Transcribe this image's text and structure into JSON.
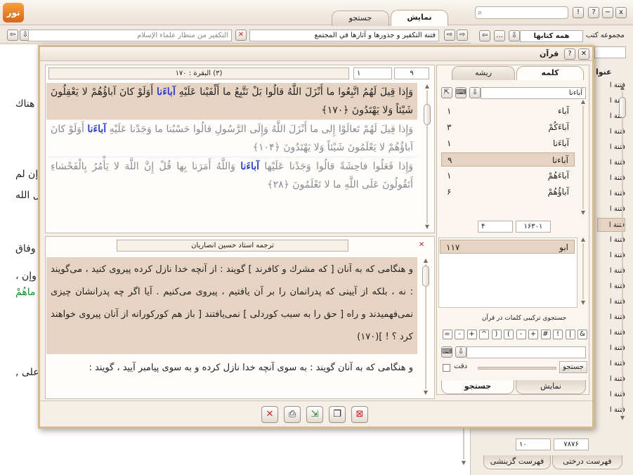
{
  "app": {
    "tabs": [
      "نمایش",
      "جستجو"
    ],
    "search_placeholder": "",
    "window_buttons": [
      "x",
      "−",
      "?",
      "!"
    ]
  },
  "docbar": {
    "left_field": "التكفير من منظار علماء الإسلام",
    "right_field": "فتنة التكفير و جذورها و آثارها في المجتمع"
  },
  "left_sidebar": {
    "collection_label": "مجموعه كتب",
    "collection_value": "همه كتابها",
    "list_header": "عنوا",
    "items": [
      "فتنة ا",
      "فتنة ا",
      "فتنة ا",
      "فتنة ا",
      "فتنة ا",
      "فتنة ا",
      "فتنة ا",
      "فتنة ا",
      "فتنة ا",
      "فتنة ا",
      "فتنة ا",
      "فتنة ا",
      "فتنة ا",
      "فتنة ا",
      "فتنة ا",
      "فتنة ا",
      "فتنة ا",
      "فتنة ا",
      "فتنة ا",
      "فتنة ا",
      "فتنة ا",
      "فتنة ا"
    ],
    "selected_index": 9,
    "page_total": "۷۸۷۶",
    "page_current": "۱۰",
    "bottom_tabs": [
      "فهرست درختی",
      "فهرست گزینشی"
    ]
  },
  "background_text": {
    "snippets": [
      "هناك",
      "إن لم",
      "ل الله.",
      "وفاق",
      "، وإن",
      "ماهُمْ",
      ", على"
    ]
  },
  "dialog": {
    "title": "قرآن",
    "verse_ref": "(۳) البقرة : ۱۷۰",
    "page_num": "۹",
    "page_total": "۱",
    "tabs": [
      "كلمه",
      "ریشه"
    ],
    "search_word": "آباءنا",
    "words": [
      {
        "word": "آباء",
        "count": "۱"
      },
      {
        "word": "آباءَكُمْ",
        "count": "۳"
      },
      {
        "word": "آباءَنا",
        "count": "۱"
      },
      {
        "word": "آباءنا",
        "count": "۹"
      },
      {
        "word": "آباءَهُمْ",
        "count": "۱"
      },
      {
        "word": "آباؤُهُمْ",
        "count": "۶"
      }
    ],
    "selected_word": 3,
    "total_left": "۴",
    "total_right": "۱۶۳۰۱",
    "root_list": [
      {
        "word": "ابو",
        "count": "۱۱۷"
      }
    ],
    "combo_label": "جستجوی تركیبی كلمات در قرآن",
    "symbols": [
      "&",
      "|",
      "!",
      "#",
      "+",
      "-",
      "(",
      ")",
      "^",
      "+",
      "-",
      "="
    ],
    "search_button": "جستجو",
    "exact_label": "دقت",
    "bottom_tabs": [
      "نمایش",
      "جستجو"
    ],
    "verses": [
      {
        "pre": "وَإِذا قِيلَ لَهُمُ اتَّبِعُوا ما أَنْزَلَ اللَّهُ قالُوا بَلْ نَتَّبِعُ ما أَلْفَيْنا عَلَيْهِ ",
        "hl": "آباءَنا",
        "post": " أَوَلَوْ كانَ آباؤُهُمْ لا يَعْقِلُونَ شَيْئاً وَلا يَهْتَدُونَ ﴿۱۷۰﴾"
      },
      {
        "pre": "وَإِذا قِيلَ لَهُمْ تَعالَوْا إِلى ما أَنْزَلَ اللَّهُ وَإِلَى الرَّسُولِ قالُوا حَسْبُنا ما وَجَدْنا عَلَيْهِ ",
        "hl": "آباءَنا",
        "post": " أَوَلَوْ كانَ آباؤُهُمْ لا يَعْلَمُونَ شَيْئاً وَلا يَهْتَدُونَ ﴿۱۰۴﴾"
      },
      {
        "pre": "وَإِذا فَعَلُوا فاحِشَةً قالُوا وَجَدْنا عَلَيْها ",
        "hl": "آباءَنا",
        "post": " وَاللَّهُ أَمَرَنا بِها قُلْ إِنَّ اللَّهَ لا يَأْمُرُ بِالْفَحْشاءِ أَتَقُولُونَ عَلَى اللَّهِ ما لا تَعْلَمُونَ ﴿۲۸﴾"
      }
    ],
    "translator": "ترجمه استاد حسین انصاریان",
    "translation": [
      "و هنگامی كه به آنان [ كه مشرك و كافرند ] گویند : از آنچه خدا نازل كرده پیروی كنید ، می‌گویند : نه ، بلكه از آیینی كه پدرانمان را بر آن یافتیم ، پیروی می‌كنیم . آیا اگر چه پدرانشان چیزی نمی‌فهمیدند و راه [ حق را به سبب كوردلی ] نمی‌یافتند [ باز هم كوركورانه از آنان پیروی خواهند كرد ؟ ! ](۱۷۰)",
      "و هنگامی كه به آنان گویند : به سوی آنچه خدا نازل كرده و به سوی پیامبر آیید ، گویند :"
    ]
  },
  "colors": {
    "accent": "#e6d3c1",
    "highlight_word": "#2a3fc4",
    "close_red": "#cc2222",
    "green_text": "#1a8a2a"
  }
}
